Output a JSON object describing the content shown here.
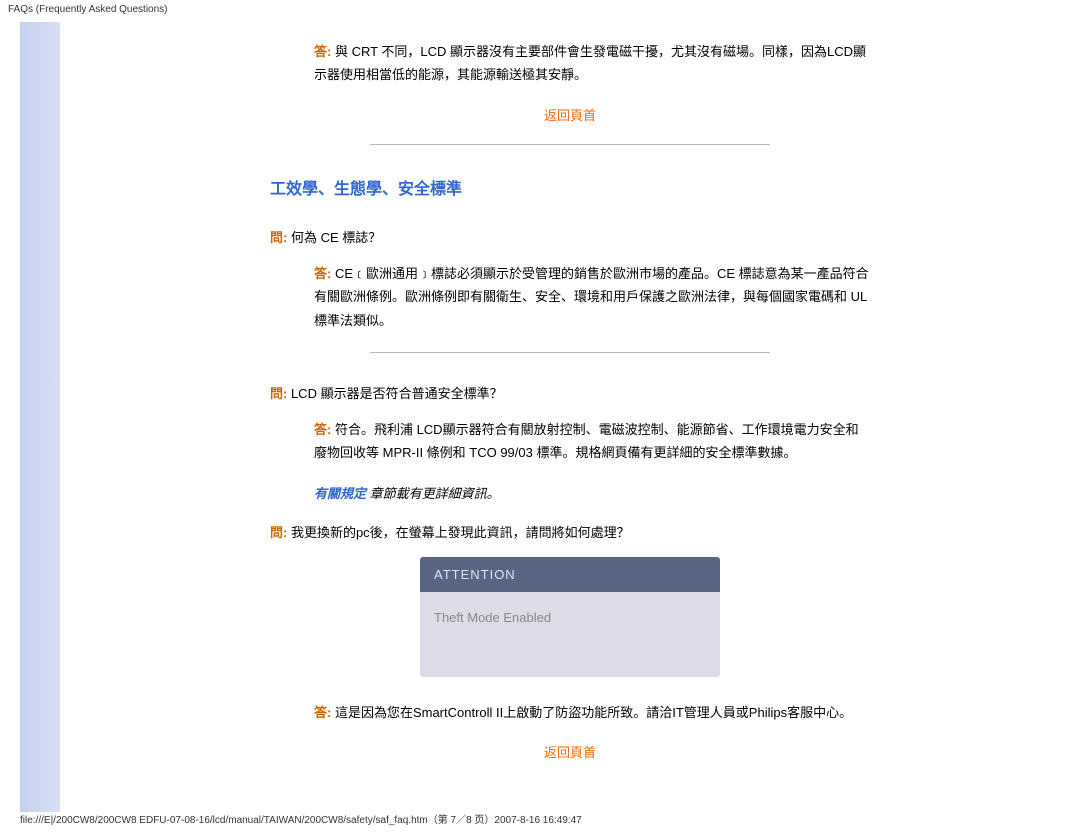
{
  "header": {
    "title": "FAQs (Frequently Asked Questions)"
  },
  "faq1": {
    "answer_prefix": "答:",
    "answer_text": " 與 CRT 不同，LCD 顯示器沒有主要部件會生發電磁干擾，尤其沒有磁場。同樣，因為LCD顯示器使用相當低的能源，其能源輸送極其安靜。"
  },
  "back_to_top": "返回頁首",
  "section_title": "工效學、生態學、安全標準",
  "q_ce": {
    "prefix": "問:",
    "text": " 何為 CE 標誌？",
    "answer_prefix": "答:",
    "answer_text": " CE﹝歐洲通用﹞標誌必須顯示於受管理的銷售於歐洲市場的產品。CE 標誌意為某一產品符合有關歐洲條例。歐洲條例即有關衛生、安全、環境和用戶保護之歐洲法律，與每個國家電碼和 UL 標準法類似。"
  },
  "q_safety": {
    "prefix": "問:",
    "text": " LCD 顯示器是否符合普通安全標準？",
    "answer_prefix": "答:",
    "answer_text": " 符合。飛利浦 LCD顯示器符合有關放射控制、電磁波控制、能源節省、工作環境電力安全和廢物回收等 MPR-II 條例和 TCO 99/03 標準。規格網頁備有更詳細的安全標準數據。"
  },
  "regulation": {
    "link_text": "有關規定",
    "text": " 章節載有更詳細資訊。"
  },
  "q_theft": {
    "prefix": "問:",
    "text": " 我更換新的pc後，在螢幕上發現此資訊，請問將如何處理？",
    "answer_prefix": "答:",
    "answer_text": " 這是因為您在SmartControll II上啟動了防盜功能所致。請洽IT管理人員或Philips客服中心。"
  },
  "alert_box": {
    "header": "ATTENTION",
    "body": "Theft Mode Enabled"
  },
  "footer": {
    "path": "file:///E|/200CW8/200CW8 EDFU-07-08-16/lcd/manual/TAIWAN/200CW8/safety/saf_faq.htm（第 7／8 页）2007-8-16 16:49:47"
  }
}
